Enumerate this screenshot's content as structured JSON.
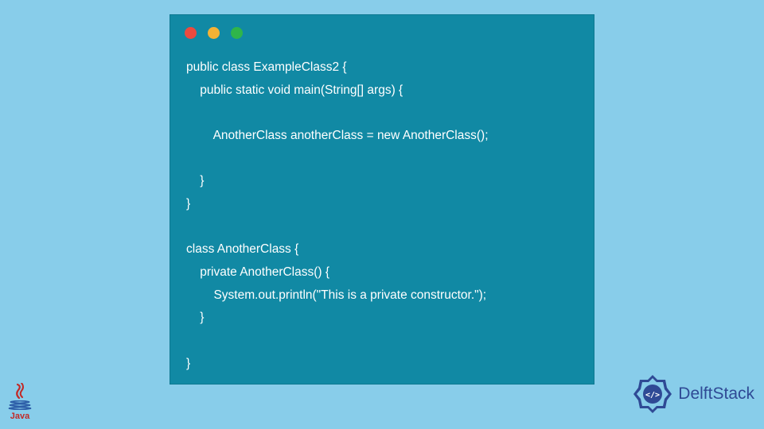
{
  "window": {
    "buttons": [
      "red",
      "yellow",
      "green"
    ]
  },
  "code": {
    "line1": "public class ExampleClass2 {",
    "line2": "    public static void main(String[] args) {",
    "line3": "",
    "line4": "        AnotherClass anotherClass = new AnotherClass();",
    "line5": "",
    "line6": "    }",
    "line7": "}",
    "line8": "",
    "line9": "class AnotherClass {",
    "line10": "    private AnotherClass() {",
    "line11": "        System.out.println(\"This is a private constructor.\");",
    "line12": "    }",
    "line13": "",
    "line14": "}"
  },
  "logos": {
    "java_text": "Java",
    "delft_text": "DelftStack"
  }
}
